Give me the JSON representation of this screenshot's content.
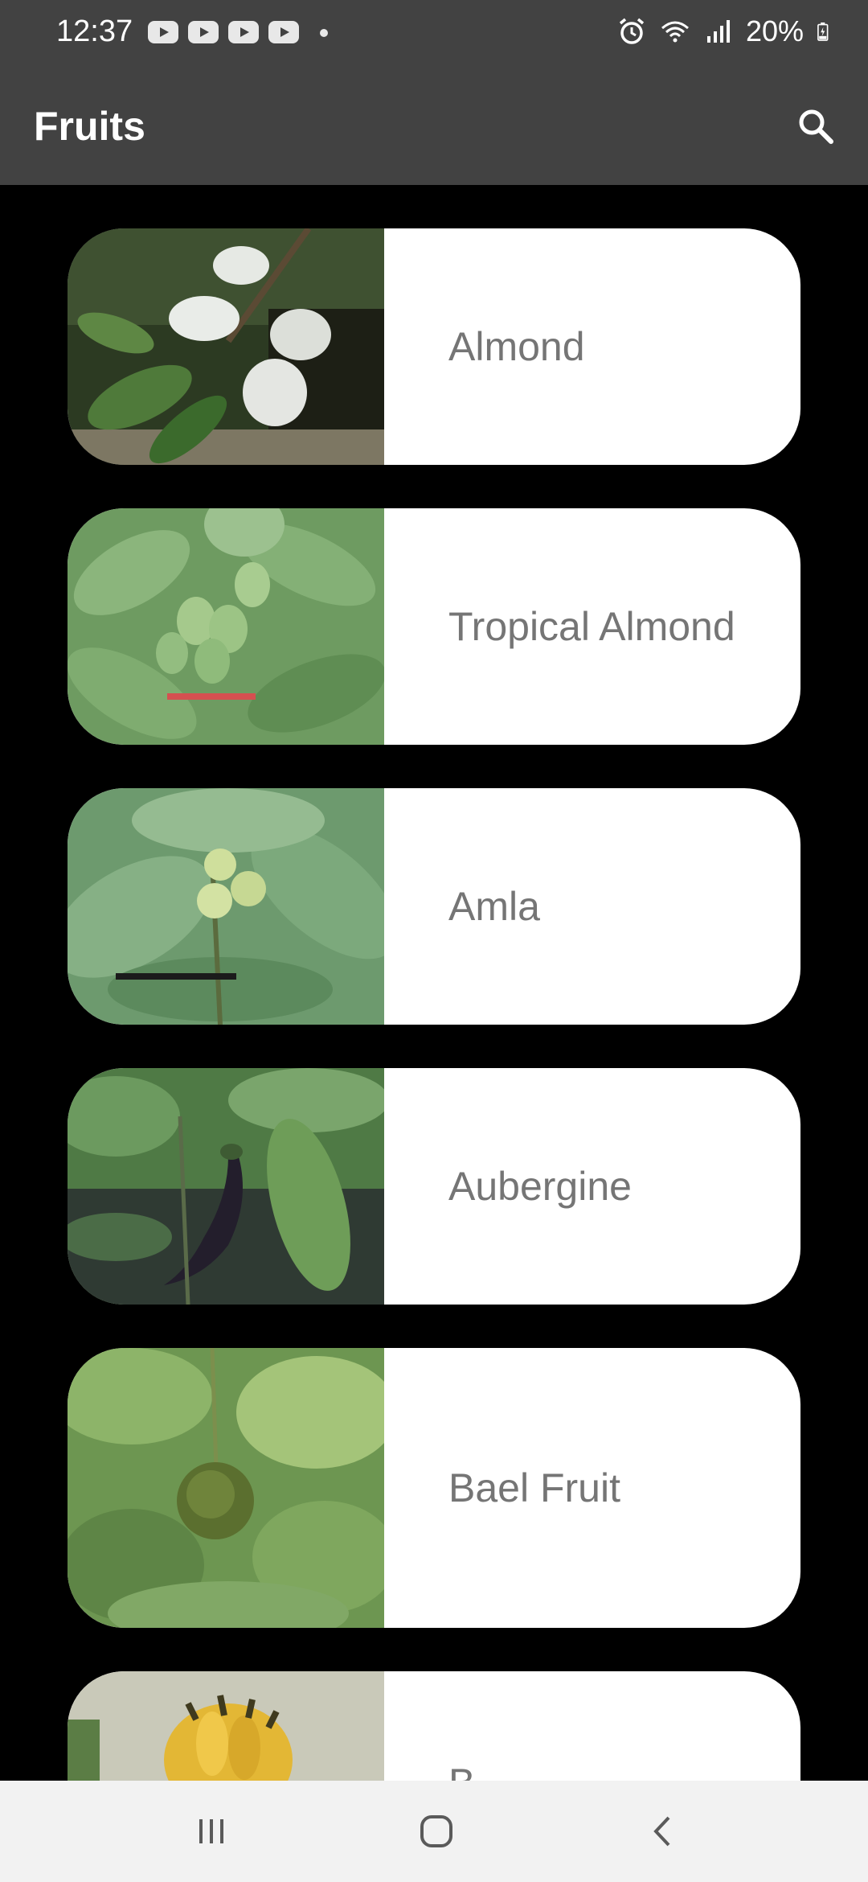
{
  "status_bar": {
    "time": "12:37",
    "battery": "20%",
    "notification_icons": [
      "youtube-icon",
      "youtube-icon",
      "youtube-icon",
      "youtube-icon"
    ],
    "system_icons": [
      "alarm-icon",
      "wifi-icon",
      "signal-icon",
      "battery-charging-icon"
    ]
  },
  "app_bar": {
    "title": "Fruits",
    "action_icon": "search-icon"
  },
  "fruits": [
    {
      "name": "Almond"
    },
    {
      "name": "Tropical Almond"
    },
    {
      "name": "Amla"
    },
    {
      "name": "Aubergine"
    },
    {
      "name": "Bael Fruit"
    },
    {
      "name": "B"
    }
  ],
  "nav_bar": {
    "buttons": [
      "recent-apps-icon",
      "home-icon",
      "back-icon"
    ]
  },
  "colors": {
    "app_bar": "#424242",
    "background": "#000000",
    "card": "#ffffff",
    "label_text": "#757575",
    "nav_bar": "#f2f2f2"
  }
}
